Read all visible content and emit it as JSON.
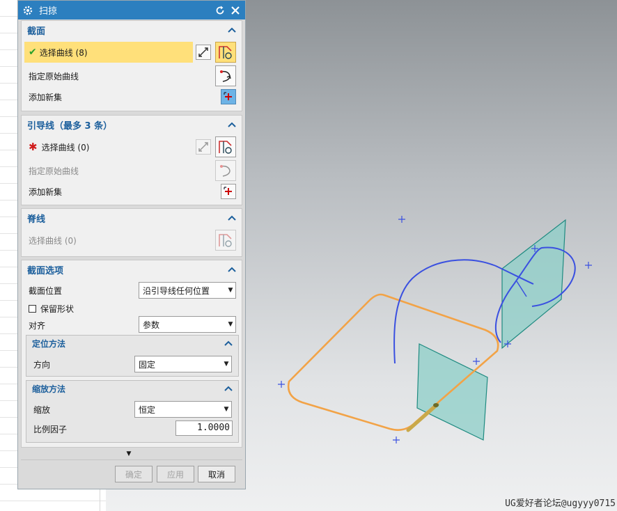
{
  "window": {
    "title": "扫掠"
  },
  "section_sections": {
    "header": "截面",
    "select_curve": "选择曲线 (8)",
    "specify_origin": "指定原始曲线",
    "add_new_set": "添加新集"
  },
  "section_guides": {
    "header": "引导线（最多 3 条）",
    "select_curve": "选择曲线 (0)",
    "specify_origin": "指定原始曲线",
    "add_new_set": "添加新集"
  },
  "section_spine": {
    "header": "脊线",
    "select_curve": "选择曲线 (0)"
  },
  "section_options": {
    "header": "截面选项",
    "position_label": "截面位置",
    "position_value": "沿引导线任何位置",
    "keep_shape_label": "保留形状",
    "keep_shape_checked": false,
    "align_label": "对齐",
    "align_value": "参数",
    "orientation": {
      "header": "定位方法",
      "direction_label": "方向",
      "direction_value": "固定"
    },
    "scaling": {
      "header": "缩放方法",
      "scale_label": "缩放",
      "scale_value": "恒定",
      "factor_label": "比例因子",
      "factor_value": "1.0000"
    }
  },
  "buttons": {
    "ok": "确定",
    "apply": "应用",
    "cancel": "取消"
  },
  "watermark": "UG爱好者论坛@ugyyy0715",
  "colors": {
    "title_bar": "#2c7fbf",
    "section_header": "#1c5f9c",
    "selection_highlight": "#ffe07a",
    "orange_curve": "#f2a347",
    "blue_curve": "#3a50e0",
    "plane_fill": "#8ecfc8",
    "plane_edge": "#1e8a80"
  }
}
